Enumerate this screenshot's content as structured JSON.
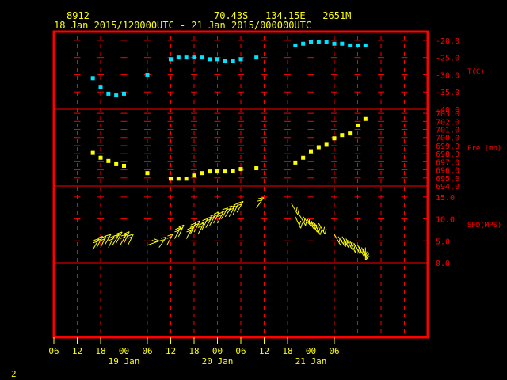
{
  "header": {
    "station_id": "8912",
    "location": "70.43S   134.15E   2651M",
    "time_range": "18 Jan 2015/120000UTC - 21 Jan 2015/000000UTC"
  },
  "page_number": "2",
  "colors": {
    "background": "#000000",
    "frame": "#ff0000",
    "header_text": "#ffff00",
    "axis_text": "#ff0000",
    "time_labels": "#ffff00",
    "temperature": "#00e5ff",
    "pressure": "#ffff00",
    "wind": "#ffff00"
  },
  "time_axis": {
    "tick_labels": [
      "06",
      "12",
      "18",
      "00",
      "06",
      "12",
      "18",
      "00",
      "06",
      "12",
      "18",
      "00",
      "06"
    ],
    "date_labels": [
      "19 Jan",
      "20 Jan",
      "21 Jan"
    ]
  },
  "chart_data": [
    {
      "type": "scatter",
      "panel": "temperature",
      "ylabel": "T(C)",
      "ylim": [
        -40,
        -17.5
      ],
      "yticks": [
        -20,
        -25,
        -30,
        -35,
        -40
      ],
      "ytick_labels": [
        "-20.0",
        "-25.0",
        "-30.0",
        "-35.0",
        "-40.0"
      ],
      "x_unit": "hours since 18 Jan 06 UTC",
      "x": [
        10,
        12,
        14,
        16,
        18,
        24,
        30,
        32,
        34,
        36,
        38,
        40,
        42,
        44,
        46,
        48,
        52,
        62,
        64,
        66,
        68,
        70,
        72,
        74,
        76,
        78,
        80
      ],
      "y": [
        -31,
        -33.5,
        -35.5,
        -36,
        -35.5,
        -30,
        -25.5,
        -25,
        -25,
        -25,
        -25,
        -25.5,
        -25.5,
        -26,
        -26,
        -25.5,
        -25,
        -21.5,
        -21,
        -20.5,
        -20.5,
        -20.5,
        -21,
        -21,
        -21.5,
        -21.5,
        -21.5
      ]
    },
    {
      "type": "scatter",
      "panel": "pressure",
      "ylabel": "Pre (mb)",
      "ylim": [
        694,
        703.5
      ],
      "yticks": [
        694,
        695,
        696,
        697,
        698,
        699,
        700,
        701,
        702,
        703
      ],
      "ytick_labels": [
        "694.0",
        "695.0",
        "696.0",
        "697.0",
        "698.0",
        "699.0",
        "700.0",
        "701.0",
        "702.0",
        "703.0"
      ],
      "x_unit": "hours since 18 Jan 06 UTC",
      "x": [
        10,
        12,
        14,
        16,
        18,
        24,
        30,
        32,
        34,
        36,
        38,
        40,
        42,
        44,
        46,
        48,
        52,
        62,
        64,
        66,
        68,
        70,
        72,
        74,
        76,
        78,
        80
      ],
      "y": [
        698.1,
        697.5,
        697.1,
        696.7,
        696.5,
        695.6,
        694.9,
        694.9,
        694.9,
        695.3,
        695.6,
        695.8,
        695.8,
        695.8,
        695.9,
        696.1,
        696.2,
        696.9,
        697.5,
        698.3,
        698.8,
        699.1,
        699.9,
        700.3,
        700.5,
        701.5,
        702.3
      ]
    },
    {
      "type": "barbs",
      "panel": "wind",
      "ylabel": "SPD(MPS)",
      "ylim": [
        0,
        17.5
      ],
      "yticks": [
        0,
        5,
        10,
        15
      ],
      "ytick_labels": [
        "0.0",
        "5.0",
        "10.0",
        "15.0"
      ],
      "x_unit": "hours since 18 Jan 06 UTC",
      "x": [
        10,
        11,
        12,
        13,
        14,
        15,
        16,
        17,
        18,
        19,
        24,
        27,
        29,
        31,
        32,
        34,
        35,
        36,
        37,
        38,
        39,
        40,
        41,
        42,
        43,
        44,
        45,
        46,
        47,
        52,
        61,
        62,
        63,
        64,
        65,
        66,
        67,
        68,
        72,
        73,
        74,
        75,
        76,
        77,
        78,
        79,
        80
      ],
      "speed": [
        3,
        3.5,
        3.5,
        4,
        3.5,
        4,
        4.5,
        4,
        4.5,
        4,
        4,
        3.5,
        4,
        5.5,
        6,
        5.5,
        6.5,
        7,
        6.5,
        7.5,
        8,
        8.5,
        9,
        9,
        10,
        10.5,
        10.5,
        11,
        11.5,
        12.5,
        13.5,
        10.5,
        11,
        10.5,
        10,
        9.5,
        9,
        9,
        6.5,
        6,
        6,
        5.5,
        5,
        4.5,
        4,
        3.5,
        3.5
      ],
      "direction_deg": [
        60,
        62,
        65,
        60,
        63,
        58,
        62,
        60,
        65,
        64,
        20,
        55,
        62,
        62,
        65,
        60,
        63,
        62,
        62,
        63,
        60,
        62,
        64,
        63,
        60,
        58,
        62,
        64,
        60,
        55,
        300,
        295,
        300,
        310,
        305,
        300,
        295,
        300,
        300,
        305,
        300,
        300,
        295,
        300,
        300,
        295,
        270
      ]
    }
  ]
}
